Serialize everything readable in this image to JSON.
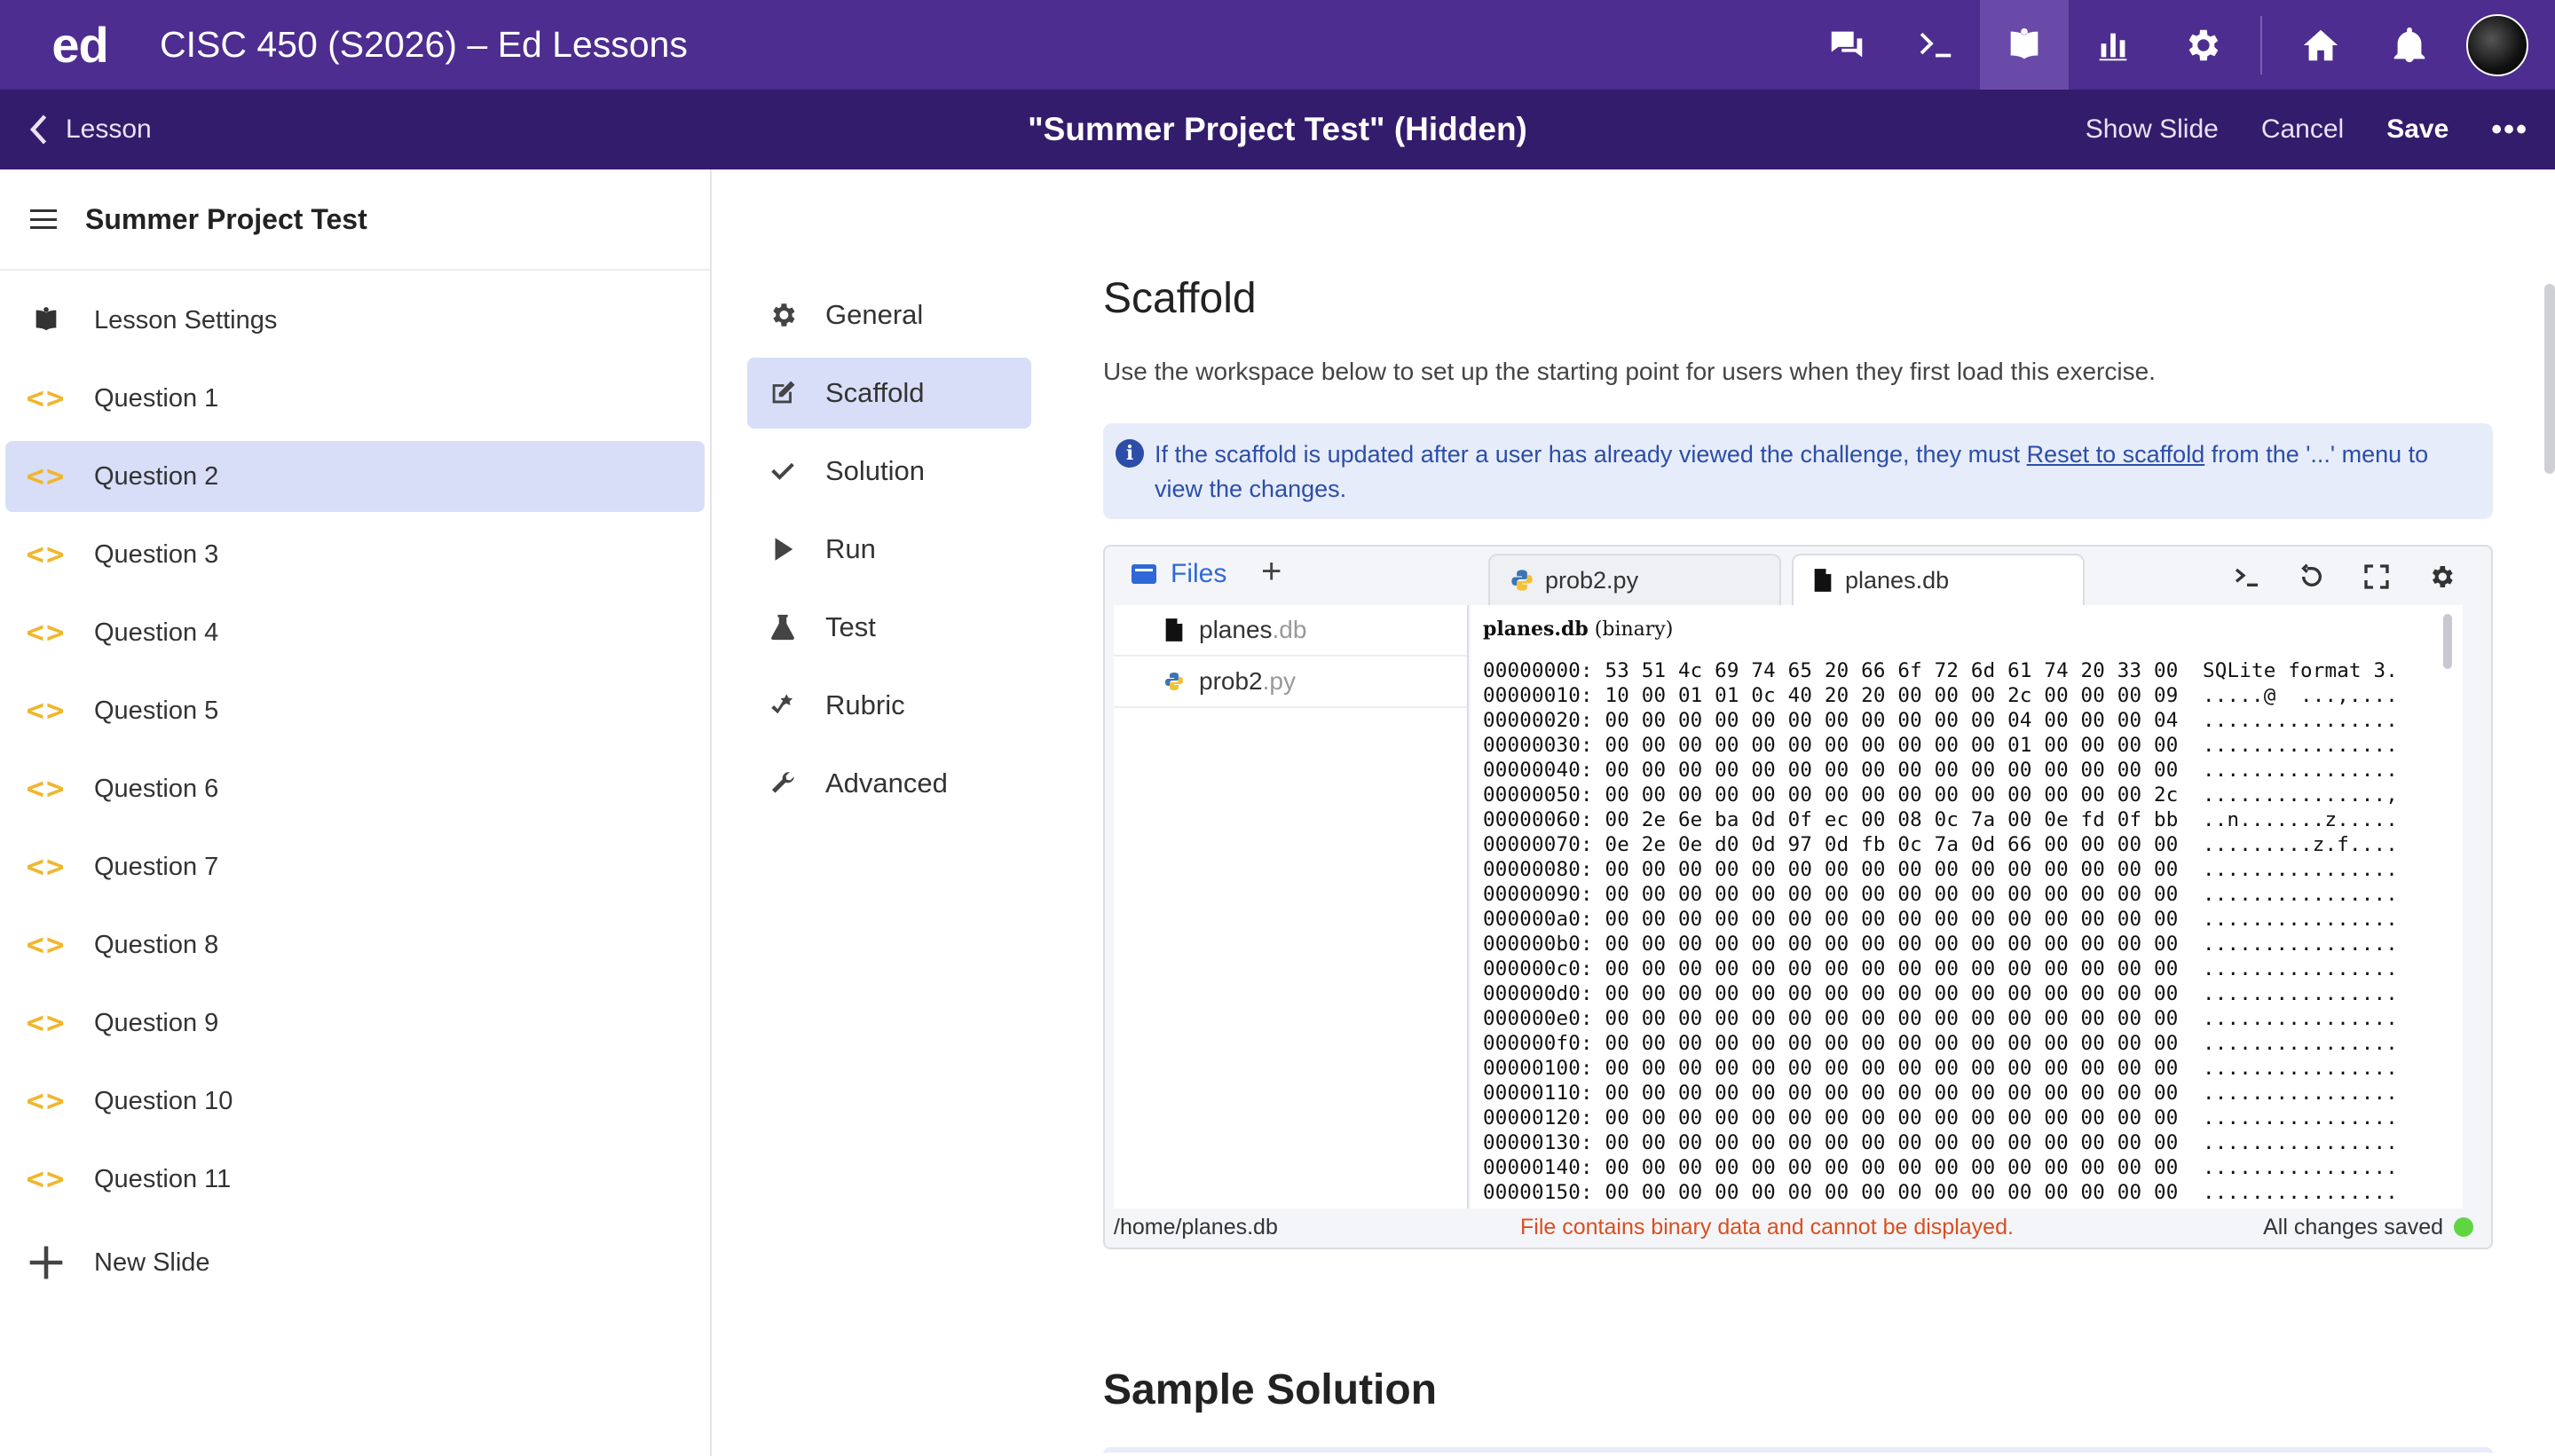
{
  "topbar": {
    "logo": "ed",
    "course_title": "CISC 450 (S2026) – Ed Lessons",
    "icons": [
      "discussion-icon",
      "terminal-icon",
      "lessons-icon",
      "analytics-icon",
      "settings-icon",
      "home-icon",
      "notifications-icon",
      "avatar"
    ],
    "brand_color": "#4d2d8f"
  },
  "subbar": {
    "back_label": "Lesson",
    "slide_title": "\"Summer Project Test\" (Hidden)",
    "show_slide": "Show Slide",
    "cancel": "Cancel",
    "save": "Save",
    "more": "•••"
  },
  "sidebar": {
    "lesson_name": "Summer Project Test",
    "settings_label": "Lesson Settings",
    "items": [
      {
        "label": "Question 1",
        "active": false
      },
      {
        "label": "Question 2",
        "active": true
      },
      {
        "label": "Question 3",
        "active": false
      },
      {
        "label": "Question 4",
        "active": false
      },
      {
        "label": "Question 5",
        "active": false
      },
      {
        "label": "Question 6",
        "active": false
      },
      {
        "label": "Question 7",
        "active": false
      },
      {
        "label": "Question 8",
        "active": false
      },
      {
        "label": "Question 9",
        "active": false
      },
      {
        "label": "Question 10",
        "active": false
      },
      {
        "label": "Question 11",
        "active": false
      }
    ],
    "new_slide": "New Slide"
  },
  "settings_nav": [
    {
      "label": "General",
      "icon": "gear-icon",
      "active": false
    },
    {
      "label": "Scaffold",
      "icon": "edit-icon",
      "active": true
    },
    {
      "label": "Solution",
      "icon": "check-icon",
      "active": false
    },
    {
      "label": "Run",
      "icon": "play-icon",
      "active": false
    },
    {
      "label": "Test",
      "icon": "flask-icon",
      "active": false
    },
    {
      "label": "Rubric",
      "icon": "rubric-icon",
      "active": false
    },
    {
      "label": "Advanced",
      "icon": "wrench-icon",
      "active": false
    }
  ],
  "main": {
    "heading": "Scaffold",
    "description": "Use the workspace below to set up the starting point for users when they first load this exercise.",
    "info": {
      "before": "If the scaffold is updated after a user has already viewed the challenge, they must ",
      "link": "Reset to scaffold",
      "after": " from the '...' menu to view the changes."
    },
    "sample_heading": "Sample Solution"
  },
  "workspace": {
    "files_label": "Files",
    "add": "+",
    "tabs": [
      {
        "name": "prob2.py",
        "icon": "python-icon"
      },
      {
        "name": "planes.db",
        "icon": "document-icon"
      }
    ],
    "tree": [
      {
        "base": "planes",
        "ext": ".db",
        "icon": "document-icon"
      },
      {
        "base": "prob2",
        "ext": ".py",
        "icon": "python-icon"
      }
    ],
    "hex_title_name": "planes.db",
    "hex_title_suffix": " (binary)",
    "hex_lines": [
      "00000000: 53 51 4c 69 74 65 20 66 6f 72 6d 61 74 20 33 00  SQLite format 3.",
      "00000010: 10 00 01 01 0c 40 20 20 00 00 00 2c 00 00 00 09  .....@  ...,....",
      "00000020: 00 00 00 00 00 00 00 00 00 00 00 04 00 00 00 04  ................",
      "00000030: 00 00 00 00 00 00 00 00 00 00 00 01 00 00 00 00  ................",
      "00000040: 00 00 00 00 00 00 00 00 00 00 00 00 00 00 00 00  ................",
      "00000050: 00 00 00 00 00 00 00 00 00 00 00 00 00 00 00 2c  ...............,",
      "00000060: 00 2e 6e ba 0d 0f ec 00 08 0c 7a 00 0e fd 0f bb  ..n.......z.....",
      "00000070: 0e 2e 0e d0 0d 97 0d fb 0c 7a 0d 66 00 00 00 00  .........z.f....",
      "00000080: 00 00 00 00 00 00 00 00 00 00 00 00 00 00 00 00  ................",
      "00000090: 00 00 00 00 00 00 00 00 00 00 00 00 00 00 00 00  ................",
      "000000a0: 00 00 00 00 00 00 00 00 00 00 00 00 00 00 00 00  ................",
      "000000b0: 00 00 00 00 00 00 00 00 00 00 00 00 00 00 00 00  ................",
      "000000c0: 00 00 00 00 00 00 00 00 00 00 00 00 00 00 00 00  ................",
      "000000d0: 00 00 00 00 00 00 00 00 00 00 00 00 00 00 00 00  ................",
      "000000e0: 00 00 00 00 00 00 00 00 00 00 00 00 00 00 00 00  ................",
      "000000f0: 00 00 00 00 00 00 00 00 00 00 00 00 00 00 00 00  ................",
      "00000100: 00 00 00 00 00 00 00 00 00 00 00 00 00 00 00 00  ................",
      "00000110: 00 00 00 00 00 00 00 00 00 00 00 00 00 00 00 00  ................",
      "00000120: 00 00 00 00 00 00 00 00 00 00 00 00 00 00 00 00  ................",
      "00000130: 00 00 00 00 00 00 00 00 00 00 00 00 00 00 00 00  ................",
      "00000140: 00 00 00 00 00 00 00 00 00 00 00 00 00 00 00 00  ................",
      "00000150: 00 00 00 00 00 00 00 00 00 00 00 00 00 00 00 00  ................"
    ],
    "status_path": "/home/planes.db",
    "status_binary": "File contains binary data and cannot be displayed.",
    "status_saved": "All changes saved",
    "status_color": "#d94f1f",
    "saved_dot_color": "#5fd641"
  }
}
